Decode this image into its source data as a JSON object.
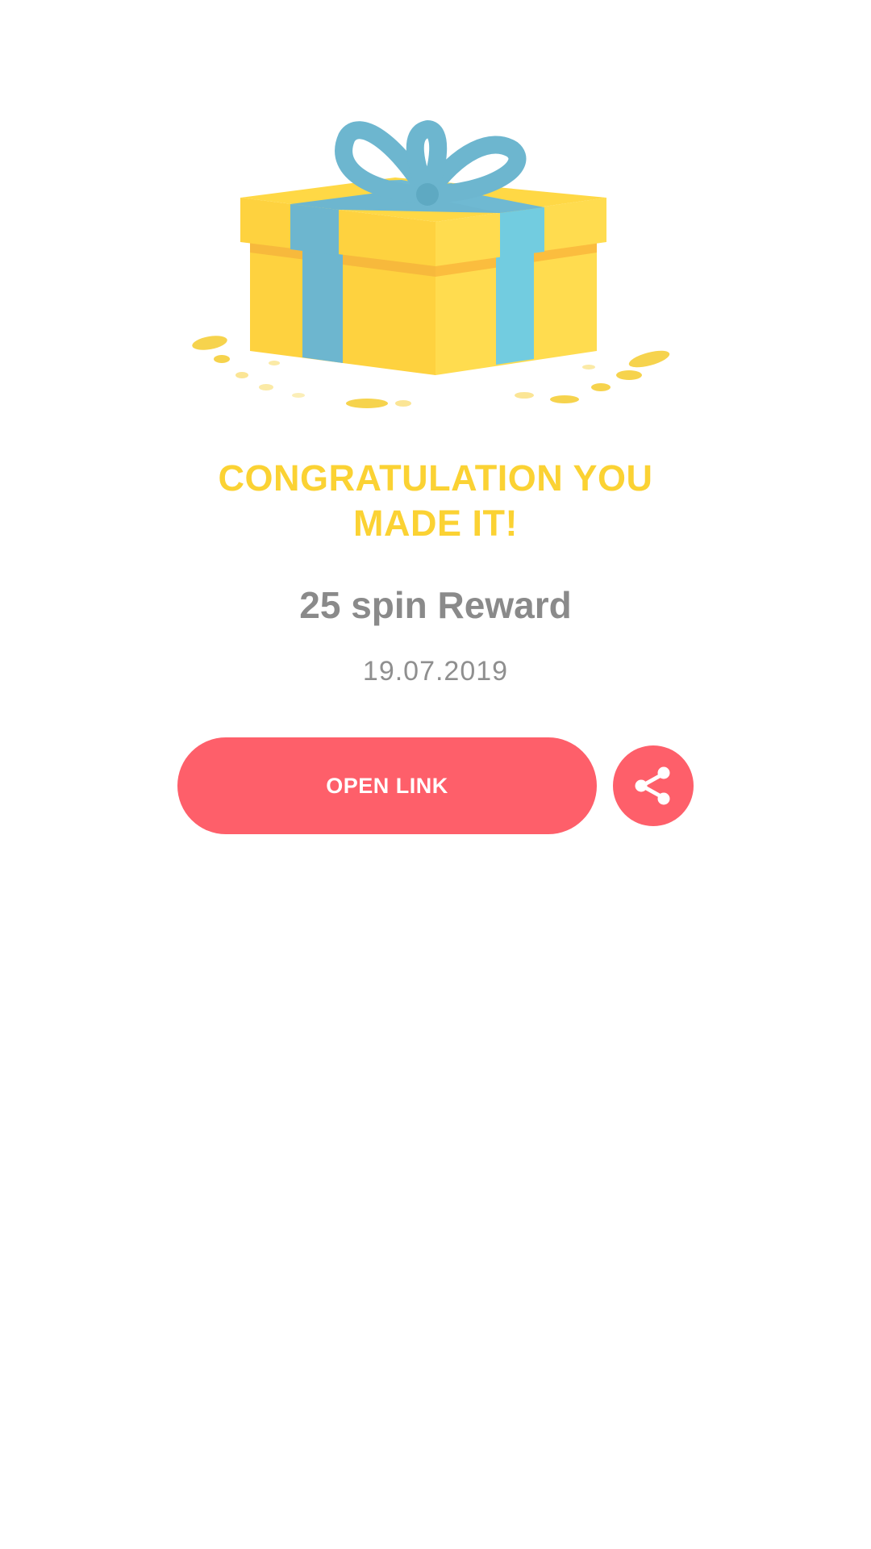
{
  "reward_card": {
    "title_line1": "CONGRATULATION YOU",
    "title_line2": "MADE IT!",
    "reward_label": "25 spin Reward",
    "date": "19.07.2019"
  },
  "actions": {
    "open_link_label": "OPEN LINK",
    "share_icon": "share-icon"
  },
  "colors": {
    "title": "#fbd233",
    "accent": "#fe5f6a",
    "text_gray": "#8a8a8a",
    "gift_yellow": "#fed544",
    "ribbon_blue": "#6fc3dd"
  }
}
